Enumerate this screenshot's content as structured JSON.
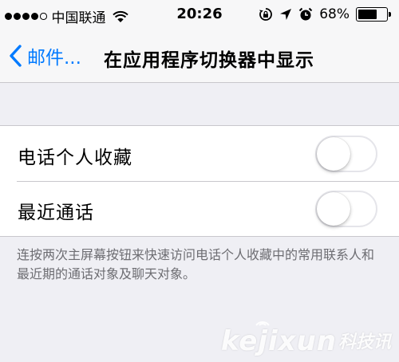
{
  "status_bar": {
    "carrier": "中国联通",
    "time": "20:26",
    "battery_percent": "68%",
    "battery_level": 0.68,
    "signal_bars_filled": 4,
    "signal_bars_total": 5
  },
  "nav": {
    "back_label": "邮件...",
    "title": "在应用程序切换器中显示"
  },
  "settings": {
    "items": [
      {
        "label": "电话个人收藏",
        "on": false
      },
      {
        "label": "最近通话",
        "on": false
      }
    ],
    "footer": "连按两次主屏幕按钮来快速访问电话个人收藏中的常用联系人和最近期的通话对象及聊天对象。"
  },
  "watermark": {
    "latin": "kejixun",
    "cn": "科技讯"
  },
  "colors": {
    "accent": "#007aff",
    "background": "#efeff4",
    "separator": "#c8c7cc"
  }
}
